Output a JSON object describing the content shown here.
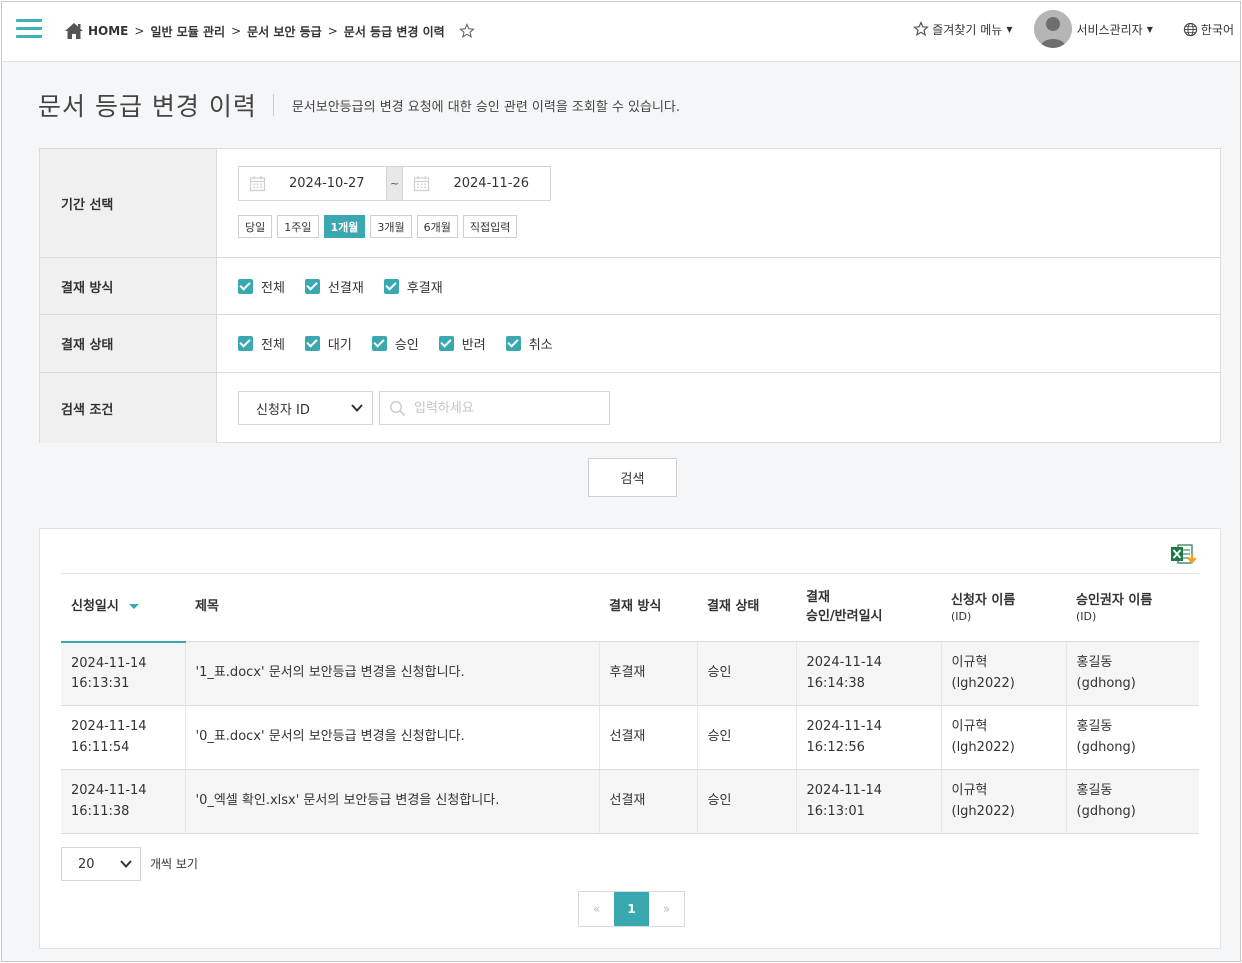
{
  "breadcrumb": {
    "home": "HOME",
    "sep": ">",
    "items": [
      "일반 모듈 관리",
      "문서 보안 등급",
      "문서 등급 변경 이력"
    ]
  },
  "topbar": {
    "favorites": "즐겨찾기 메뉴",
    "user": "서비스관리자",
    "language": "한국어"
  },
  "page": {
    "title": "문서 등급 변경 이력",
    "description": "문서보안등급의 변경 요청에 대한 승인 관련 이력을 조회할 수 있습니다."
  },
  "filter": {
    "period_label": "기간 선택",
    "date_from": "2024-10-27",
    "date_sep": "~",
    "date_to": "2024-11-26",
    "periods": [
      "당일",
      "1주일",
      "1개월",
      "3개월",
      "6개월",
      "직접입력"
    ],
    "active_period": "1개월",
    "method_label": "결재 방식",
    "methods": [
      "전체",
      "선결재",
      "후결재"
    ],
    "status_label": "결재 상태",
    "statuses": [
      "전체",
      "대기",
      "승인",
      "반려",
      "취소"
    ],
    "condition_label": "검색 조건",
    "condition_selected": "신청자 ID",
    "search_placeholder": "입력하세요",
    "search_button": "검색"
  },
  "table": {
    "headers": {
      "date": "신청일시",
      "title": "제목",
      "method": "결재 방식",
      "status": "결재 상태",
      "approval_top": "결재",
      "approval_bottom": "승인/반려일시",
      "applicant": "신청자 이름",
      "applicant_sub": "(ID)",
      "approver": "승인권자 이름",
      "approver_sub": "(ID)"
    },
    "rows": [
      {
        "date": "2024-11-14",
        "time": "16:13:31",
        "title": "'1_표.docx' 문서의 보안등급 변경을 신청합니다.",
        "method": "후결재",
        "status": "승인",
        "approved_date": "2024-11-14",
        "approved_time": "16:14:38",
        "applicant": "이규혁",
        "applicant_id": "(lgh2022)",
        "approver": "홍길동",
        "approver_id": "(gdhong)"
      },
      {
        "date": "2024-11-14",
        "time": "16:11:54",
        "title": "'0_표.docx' 문서의 보안등급 변경을 신청합니다.",
        "method": "선결재",
        "status": "승인",
        "approved_date": "2024-11-14",
        "approved_time": "16:12:56",
        "applicant": "이규혁",
        "applicant_id": "(lgh2022)",
        "approver": "홍길동",
        "approver_id": "(gdhong)"
      },
      {
        "date": "2024-11-14",
        "time": "16:11:38",
        "title": "'0_엑셀 확인.xlsx' 문서의 보안등급 변경을 신청합니다.",
        "method": "선결재",
        "status": "승인",
        "approved_date": "2024-11-14",
        "approved_time": "16:13:01",
        "applicant": "이규혁",
        "applicant_id": "(lgh2022)",
        "approver": "홍길동",
        "approver_id": "(gdhong)"
      }
    ]
  },
  "pagination": {
    "page_size": "20",
    "page_size_label": "개씩 보기",
    "prev": "«",
    "current": "1",
    "next": "»"
  },
  "colors": {
    "accent": "#3aa8b0"
  }
}
